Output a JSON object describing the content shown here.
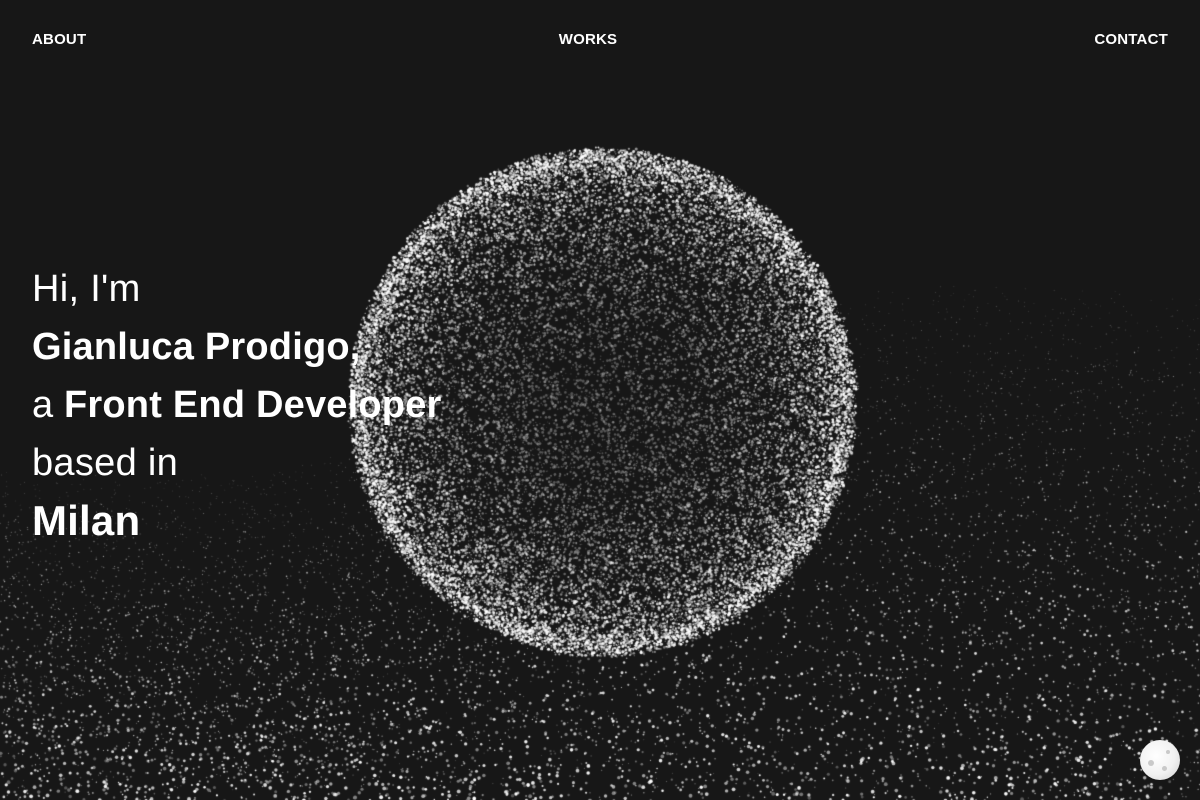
{
  "nav": {
    "about": "ABOUT",
    "works": "WORKS",
    "contact": "CONTACT"
  },
  "hero": {
    "line1": "Hi, I'm",
    "name": "Gianluca Prodigo,",
    "role_prefix": "a",
    "role": "Front End Developer",
    "location_prefix": "based in",
    "city": "Milan"
  },
  "colors": {
    "background": "#171717",
    "text": "#ffffff",
    "particle": "#ffffff"
  },
  "icons": {
    "theme_toggle": "moon-icon"
  }
}
